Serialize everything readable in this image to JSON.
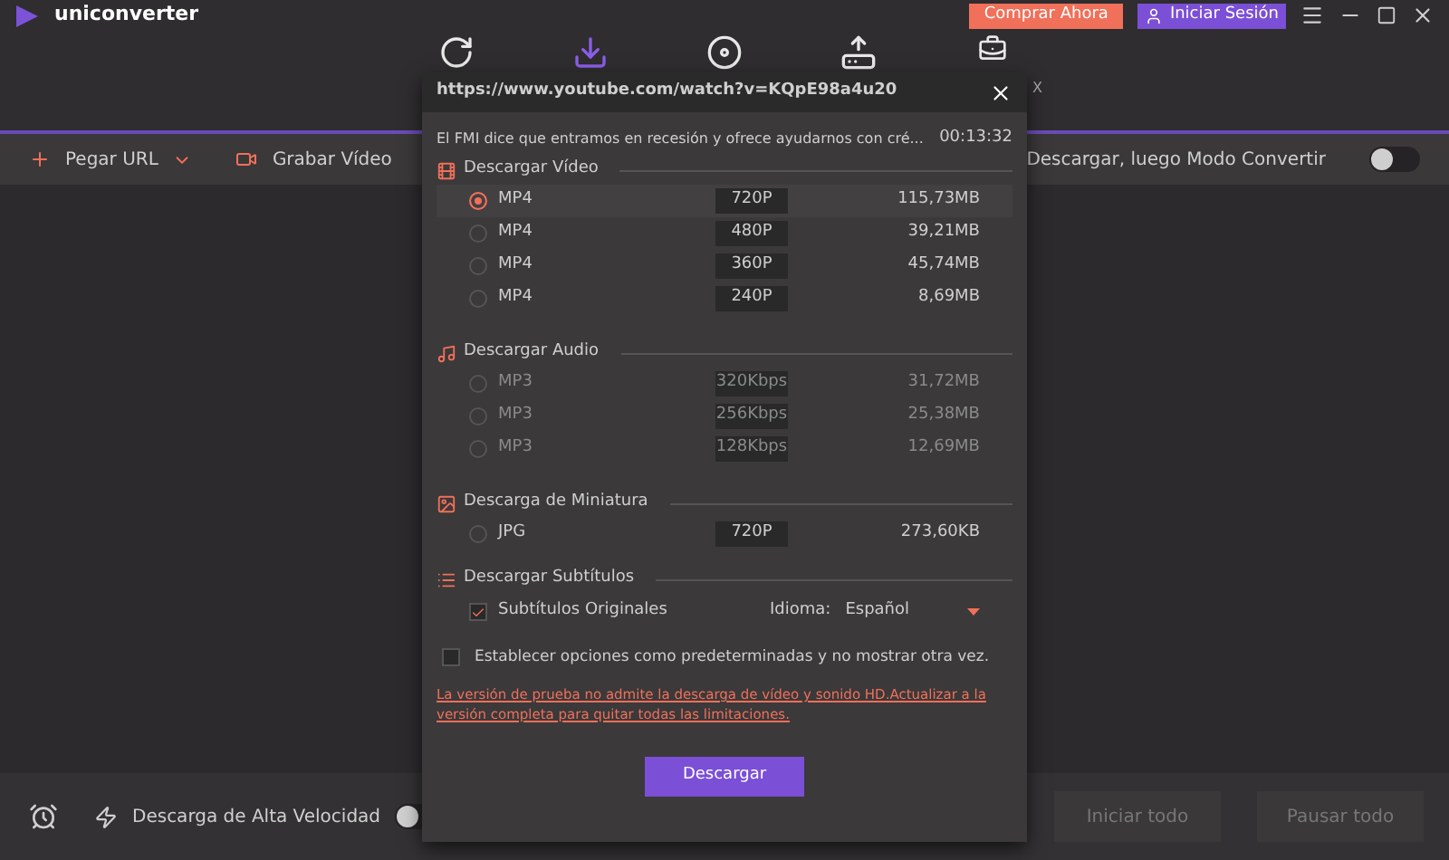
{
  "app": {
    "name": "uniconverter",
    "buy_button": "Comprar Ahora",
    "login_button": "Iniciar Sesión"
  },
  "nav_tabs": [
    {
      "selected": false
    },
    {
      "selected": true
    },
    {
      "selected": false
    },
    {
      "selected": false
    },
    {
      "selected": false,
      "label": "X"
    }
  ],
  "toolbar": {
    "paste_url": "Pegar URL",
    "record_video": "Grabar Vídeo",
    "convert_mode_label": "Descargar, luego Modo Convertir",
    "convert_mode_on": false
  },
  "bottom_bar": {
    "high_speed_label": "Descarga de Alta Velocidad",
    "high_speed_on": false,
    "start_all": "Iniciar todo",
    "pause_all": "Pausar todo"
  },
  "dialog": {
    "url": "https://www.youtube.com/watch?v=KQpE98a4u20",
    "video_title": "El FMI dice que entramos en recesión y ofrece ayudarnos con cré...",
    "duration": "00:13:32",
    "sections": [
      {
        "title": "Descargar Vídeo",
        "options": [
          {
            "format": "MP4",
            "quality": "720P",
            "size": "115,73MB",
            "selected": true,
            "disabled": false
          },
          {
            "format": "MP4",
            "quality": "480P",
            "size": "39,21MB",
            "selected": false,
            "disabled": false
          },
          {
            "format": "MP4",
            "quality": "360P",
            "size": "45,74MB",
            "selected": false,
            "disabled": false
          },
          {
            "format": "MP4",
            "quality": "240P",
            "size": "8,69MB",
            "selected": false,
            "disabled": false
          }
        ]
      },
      {
        "title": "Descargar Audio",
        "options": [
          {
            "format": "MP3",
            "quality": "320Kbps",
            "size": "31,72MB",
            "selected": false,
            "disabled": true
          },
          {
            "format": "MP3",
            "quality": "256Kbps",
            "size": "25,38MB",
            "selected": false,
            "disabled": true
          },
          {
            "format": "MP3",
            "quality": "128Kbps",
            "size": "12,69MB",
            "selected": false,
            "disabled": true
          }
        ]
      },
      {
        "title": "Descarga de Miniatura",
        "options": [
          {
            "format": "JPG",
            "quality": "720P",
            "size": "273,60KB",
            "selected": false,
            "disabled": false
          }
        ]
      }
    ],
    "subtitles": {
      "title": "Descargar Subtítulos",
      "option_label": "Subtítulos Originales",
      "checked": true,
      "language_label": "Idioma:",
      "language": "Español"
    },
    "default_label": "Establecer opciones como predeterminadas y no mostrar otra vez.",
    "default_checked": false,
    "trial_notice": "La versión de prueba no admite la descarga de vídeo y sonido HD.Actualizar a la versión completa para quitar todas las limitaciones.",
    "download_button": "Descargar"
  }
}
